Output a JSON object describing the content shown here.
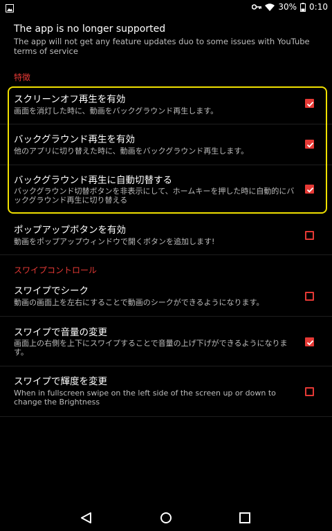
{
  "status_bar": {
    "battery_percent": "30%",
    "time": "0:10",
    "icons": [
      "image-icon",
      "key-icon",
      "wifi-icon",
      "battery-icon"
    ]
  },
  "notice": {
    "title": "The app is no longer supported",
    "description": "The app will not get any feature updates duo to some issues with YouTube terms of service"
  },
  "sections": {
    "features": {
      "header": "特徴",
      "items": [
        {
          "title": "スクリーンオフ再生を有効",
          "summary": "画面を消灯した時に、動画をバックグラウンド再生します。",
          "checked": true
        },
        {
          "title": "バックグラウンド再生を有効",
          "summary": "他のアプリに切り替えた時に、動画をバックグラウンド再生します。",
          "checked": true
        },
        {
          "title": "バックグラウンド再生に自動切替する",
          "summary": "バックグラウンド切替ボタンを非表示にして、ホームキーを押した時に自動的にバックグラウンド再生に切り替える",
          "checked": true
        },
        {
          "title": "ポップアップボタンを有効",
          "summary": "動画をポップアップウィンドウで開くボタンを追加します!",
          "checked": false
        }
      ]
    },
    "swipe": {
      "header": "スワイプコントロール",
      "items": [
        {
          "title": "スワイプでシーク",
          "summary": "動画の画面上を左右にすることで動画のシークができるようになります。",
          "checked": false
        },
        {
          "title": "スワイプで音量の変更",
          "summary": "画面上の右側を上下にスワイプすることで音量の上げ下げができるようになります。",
          "checked": true
        },
        {
          "title": "スワイプで輝度を変更",
          "summary": "When in fullscreen swipe on the left side of the screen up or down to change the Brightness",
          "checked": false
        }
      ]
    }
  },
  "nav_bar": {
    "icons": [
      "back-icon",
      "home-icon",
      "recents-icon"
    ]
  },
  "colors": {
    "accent": "#e53935",
    "highlight": "#f0e000",
    "background": "#000000",
    "summary_text": "#bdbdbd"
  }
}
